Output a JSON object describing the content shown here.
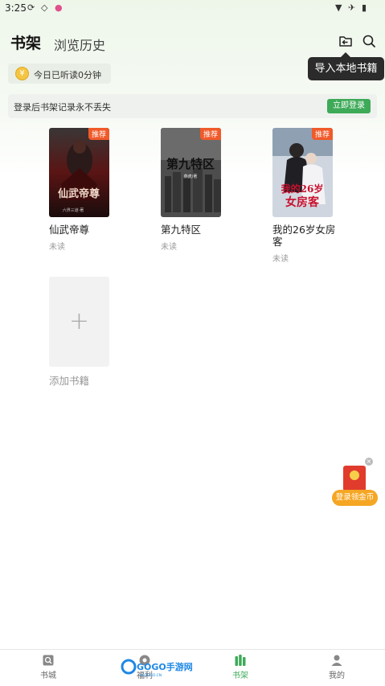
{
  "status_bar": {
    "time": "3:25"
  },
  "header": {
    "tab_bookshelf": "书架",
    "tab_history": "浏览历史"
  },
  "tooltip": {
    "text": "导入本地书籍"
  },
  "reading_time": {
    "coin_glyph": "¥",
    "text": "今日已听读0分钟"
  },
  "login_banner": {
    "text": "登录后书架记录永不丢失",
    "button": "立即登录"
  },
  "books": [
    {
      "title": "仙武帝尊",
      "status": "未读",
      "badge": "推荐",
      "cover_text": "仙武帝尊",
      "cover_author": "六界三道·著"
    },
    {
      "title": "第九特区",
      "status": "未读",
      "badge": "推荐",
      "cover_text": "第九特区",
      "cover_author": "燕虎/著"
    },
    {
      "title": "我的26岁女房客",
      "status": "未读",
      "badge": "推荐",
      "cover_text_1": "我的26岁",
      "cover_text_2": "女房客"
    }
  ],
  "add_book": {
    "plus": "+",
    "label": "添加书籍"
  },
  "floating_reward": {
    "close": "×",
    "label": "登录领金币"
  },
  "bottom_nav": [
    {
      "label": "书城",
      "icon": "book-city-icon"
    },
    {
      "label": "福利",
      "icon": "gift-icon"
    },
    {
      "label": "书架",
      "icon": "bookshelf-icon",
      "active": true
    },
    {
      "label": "我的",
      "icon": "user-icon"
    }
  ],
  "watermark": {
    "brand": "GOGO手游网",
    "url": "W.GOGO.CN"
  },
  "colors": {
    "accent": "#3eaa58",
    "badge": "#f05a2a",
    "reward_button": "#f5a623"
  }
}
